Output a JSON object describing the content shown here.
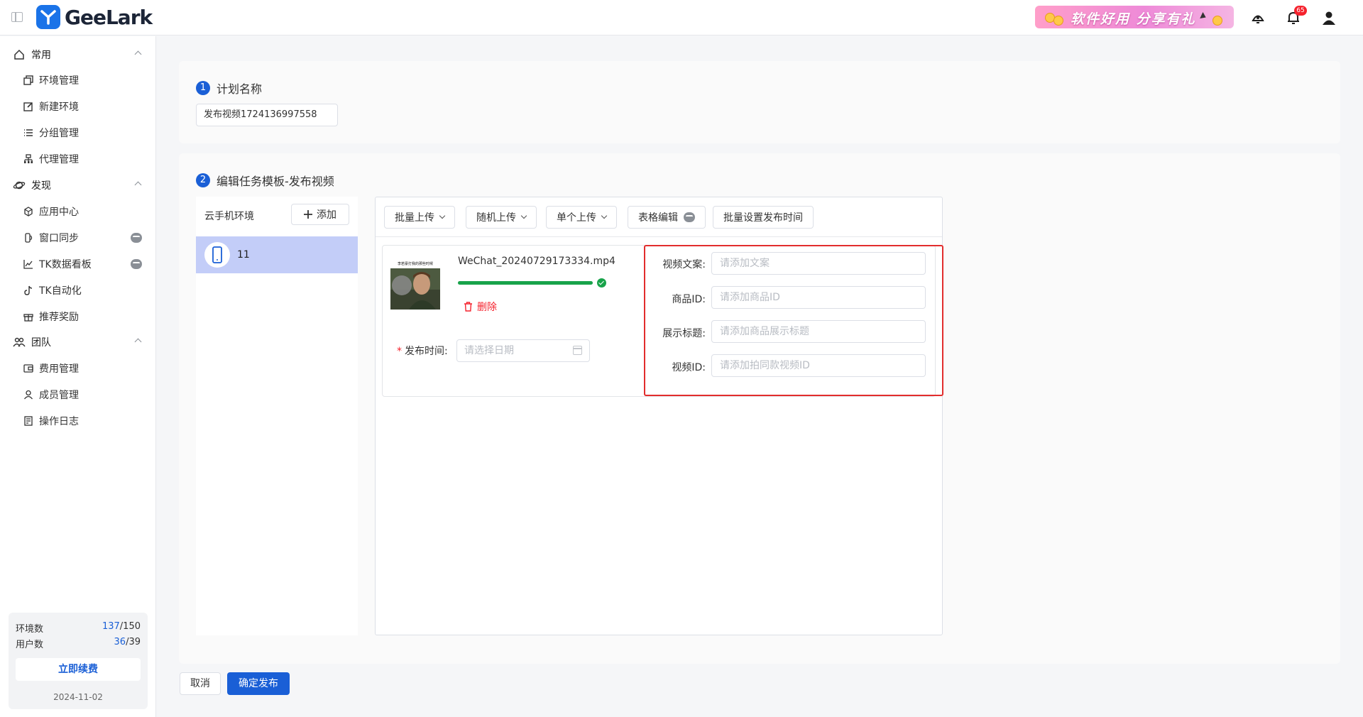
{
  "app": {
    "logo_text": "GeeLark"
  },
  "header": {
    "promo_text": "软件好用 分享有礼",
    "notification_count": "65"
  },
  "sidebar": {
    "groups": [
      {
        "label": "常用",
        "icon": "home-icon",
        "items": [
          {
            "label": "环境管理",
            "icon": "copy-icon"
          },
          {
            "label": "新建环境",
            "icon": "edit-icon"
          },
          {
            "label": "分组管理",
            "icon": "list-icon"
          },
          {
            "label": "代理管理",
            "icon": "network-icon"
          }
        ]
      },
      {
        "label": "发现",
        "icon": "planet-icon",
        "items": [
          {
            "label": "应用中心",
            "icon": "apps-icon"
          },
          {
            "label": "窗口同步",
            "icon": "sync-icon",
            "vip": true
          },
          {
            "label": "TK数据看板",
            "icon": "line-chart-icon",
            "vip": true
          },
          {
            "label": "TK自动化",
            "icon": "tiktok-icon"
          },
          {
            "label": "推荐奖励",
            "icon": "gift-icon"
          }
        ]
      },
      {
        "label": "团队",
        "icon": "team-icon",
        "items": [
          {
            "label": "费用管理",
            "icon": "wallet-icon"
          },
          {
            "label": "成员管理",
            "icon": "member-icon"
          },
          {
            "label": "操作日志",
            "icon": "log-icon"
          }
        ]
      }
    ],
    "quota": {
      "env_label": "环境数",
      "env_used": "137",
      "env_total": "/150",
      "user_label": "用户数",
      "user_used": "36",
      "user_total": "/39",
      "renew_label": "立即续费",
      "expiry": "2024-11-02"
    }
  },
  "step1": {
    "num": "1",
    "title": "计划名称",
    "plan_name": "发布视频1724136997558"
  },
  "step2": {
    "num": "2",
    "title": "编辑任务模板-发布视频",
    "env_panel": {
      "title": "云手机环境",
      "add_label": "添加",
      "env_name": "11"
    },
    "toolbar": {
      "batch_upload": "批量上传",
      "random_upload": "随机上传",
      "single_upload": "单个上传",
      "table_edit": "表格编辑",
      "batch_time": "批量设置发布时间"
    },
    "video": {
      "thumb_caption": "李若豪打我的那些时候",
      "filename": "WeChat_20240729173334.mp4",
      "progress": 1.0,
      "delete_label": "删除",
      "publish_time_label": "发布时间:",
      "date_placeholder": "请选择日期"
    },
    "fields": [
      {
        "label": "视频文案:",
        "placeholder": "请添加文案"
      },
      {
        "label": "商品ID:",
        "placeholder": "请添加商品ID"
      },
      {
        "label": "展示标题:",
        "placeholder": "请添加商品展示标题"
      },
      {
        "label": "视频ID:",
        "placeholder": "请添加拍同款视频ID"
      }
    ]
  },
  "footer": {
    "cancel_label": "取消",
    "confirm_label": "确定发布"
  },
  "colors": {
    "primary": "#1a5fd6",
    "danger": "#f5222d",
    "success": "#18a34a",
    "selected": "#c3cdf8"
  }
}
